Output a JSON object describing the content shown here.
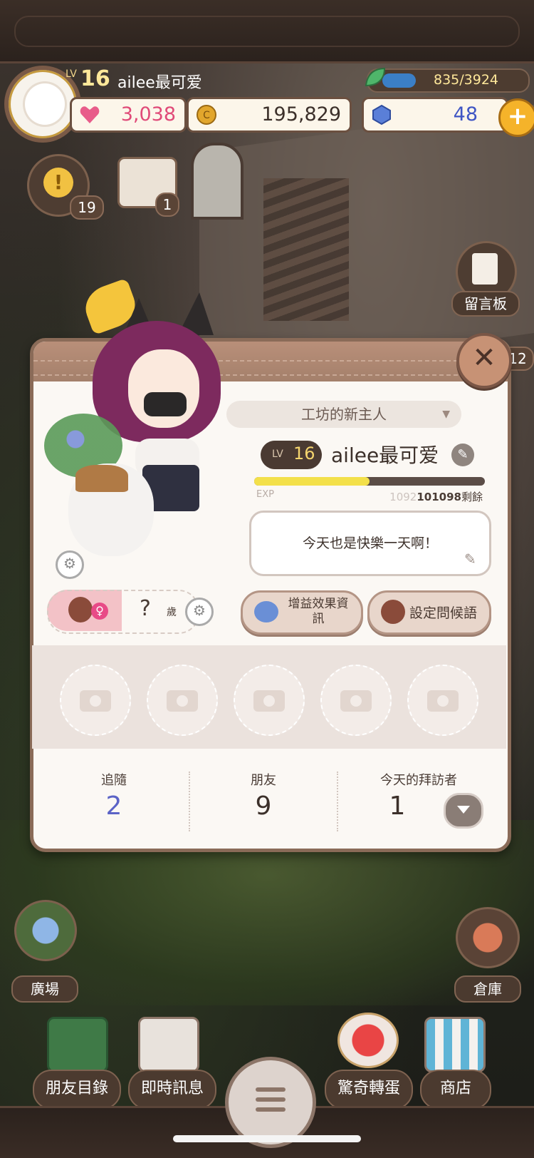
{
  "hud": {
    "level_prefix": "LV",
    "level": "16",
    "username": "ailee最可爱",
    "exp_text": "835/3924",
    "exp_fraction": 0.21,
    "hearts": "3,038",
    "coins": "195,829",
    "gems": "48",
    "plus_label": "+"
  },
  "side": {
    "alert_count": "19",
    "calendar_count": "1",
    "message_board_label": "留言板",
    "side_count": "12",
    "plaza_label": "廣場",
    "warehouse_label": "倉庫"
  },
  "profile": {
    "close_label": "✕",
    "title": "工坊的新主人",
    "level_prefix": "LV",
    "level": "16",
    "name": "ailee最可爱",
    "exp_label": "EXP",
    "exp_fraction": 0.5,
    "exp_faded": "1092",
    "exp_remaining": "101098",
    "exp_suffix": "剩餘",
    "greeting": "今天也是快樂一天啊！",
    "age_value": "?",
    "age_unit": "歲",
    "buff_button": "增益效果資訊",
    "greeting_button": "設定問候語"
  },
  "stats": {
    "follow_label": "追隨",
    "follow_value": "2",
    "friends_label": "朋友",
    "friends_value": "9",
    "visitors_label": "今天的拜訪者",
    "visitors_value": "1"
  },
  "nav": {
    "friends_list": "朋友目錄",
    "instant_message": "即時訊息",
    "gacha": "驚奇轉蛋",
    "shop": "商店"
  },
  "colors": {
    "accent_blue": "#5b63c6",
    "panel_bg": "#fbf8f4",
    "frame_brown": "#8a6b58",
    "exp_yellow": "#f3e04a"
  }
}
